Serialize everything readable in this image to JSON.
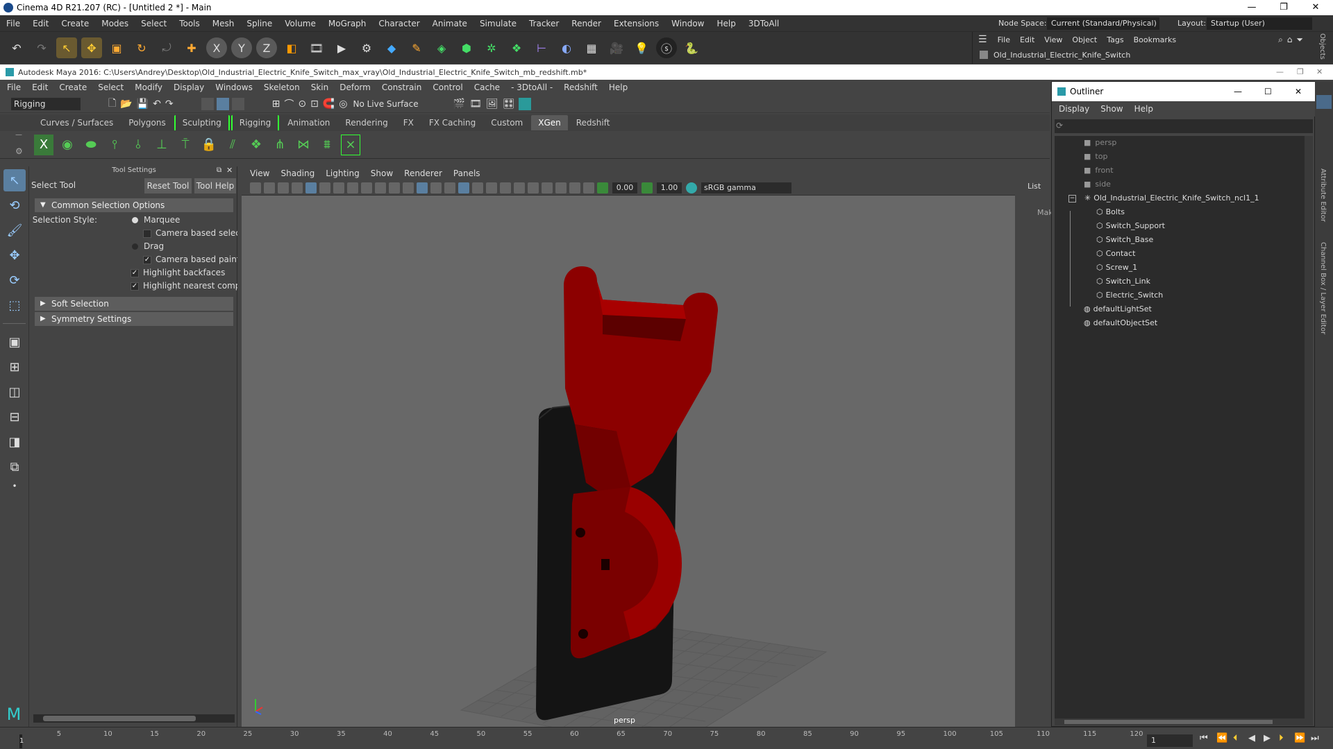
{
  "c4d": {
    "title": "Cinema 4D R21.207 (RC) - [Untitled 2 *] - Main",
    "menu": [
      "File",
      "Edit",
      "Create",
      "Modes",
      "Select",
      "Tools",
      "Mesh",
      "Spline",
      "Volume",
      "MoGraph",
      "Character",
      "Animate",
      "Simulate",
      "Tracker",
      "Render",
      "Extensions",
      "Window",
      "Help",
      "3DToAll"
    ],
    "node_space_label": "Node Space:",
    "node_space_value": "Current (Standard/Physical)",
    "layout_label": "Layout:",
    "layout_value": "Startup (User)",
    "obj_menu": [
      "File",
      "Edit",
      "View",
      "Object",
      "Tags",
      "Bookmarks"
    ],
    "obj_item": "Old_Industrial_Electric_Knife_Switch",
    "obj_side_tab": "Objects"
  },
  "maya": {
    "title": "Autodesk Maya 2016: C:\\Users\\Andrey\\Desktop\\Old_Industrial_Electric_Knife_Switch_max_vray\\Old_Industrial_Electric_Knife_Switch_mb_redshift.mb*",
    "menu": [
      "File",
      "Edit",
      "Create",
      "Select",
      "Modify",
      "Display",
      "Windows",
      "Skeleton",
      "Skin",
      "Deform",
      "Constrain",
      "Control",
      "Cache",
      "- 3DtoAll -",
      "Redshift",
      "Help"
    ],
    "mode": "Rigging",
    "live_surface": "No Live Surface",
    "shelf_tabs": [
      "Curves / Surfaces",
      "Polygons",
      "Sculpting",
      "Rigging",
      "Animation",
      "Rendering",
      "FX",
      "FX Caching",
      "Custom",
      "XGen",
      "Redshift"
    ],
    "active_shelf": "XGen",
    "tool_settings": {
      "panel_title": "Tool Settings",
      "tool_name": "Select Tool",
      "reset": "Reset Tool",
      "help": "Tool Help",
      "section1": "Common Selection Options",
      "selection_style_label": "Selection Style:",
      "marquee": "Marquee",
      "camera_based_selection": "Camera based selectio",
      "drag": "Drag",
      "camera_based_paint": "Camera based paint se",
      "highlight_backfaces": "Highlight backfaces",
      "highlight_nearest": "Highlight nearest compor",
      "section2": "Soft Selection",
      "section3": "Symmetry Settings"
    },
    "viewport": {
      "menu": [
        "View",
        "Shading",
        "Lighting",
        "Show",
        "Renderer",
        "Panels"
      ],
      "val1": "0.00",
      "val2": "1.00",
      "color_space": "sRGB gamma",
      "camera_label": "persp"
    },
    "right_gutter": {
      "list": "List",
      "mak": "Mak"
    },
    "outliner": {
      "title": "Outliner",
      "menu": [
        "Display",
        "Show",
        "Help"
      ],
      "items": [
        {
          "label": "persp"
        },
        {
          "label": "top"
        },
        {
          "label": "front"
        },
        {
          "label": "side"
        },
        {
          "label": "Old_Industrial_Electric_Knife_Switch_ncl1_1"
        },
        {
          "label": "Bolts"
        },
        {
          "label": "Switch_Support"
        },
        {
          "label": "Switch_Base"
        },
        {
          "label": "Contact"
        },
        {
          "label": "Screw_1"
        },
        {
          "label": "Switch_Link"
        },
        {
          "label": "Electric_Switch"
        },
        {
          "label": "defaultLightSet"
        },
        {
          "label": "defaultObjectSet"
        }
      ]
    },
    "side_tabs": [
      "Attribute Editor",
      "Channel Box / Layer Editor"
    ],
    "timeline": {
      "ticks": [
        "1",
        "5",
        "10",
        "15",
        "20",
        "25",
        "30",
        "35",
        "40",
        "45",
        "50",
        "55",
        "60",
        "65",
        "70",
        "75",
        "80",
        "85",
        "90",
        "95",
        "100",
        "105",
        "110",
        "115",
        "120"
      ],
      "current_frame": "1"
    }
  }
}
